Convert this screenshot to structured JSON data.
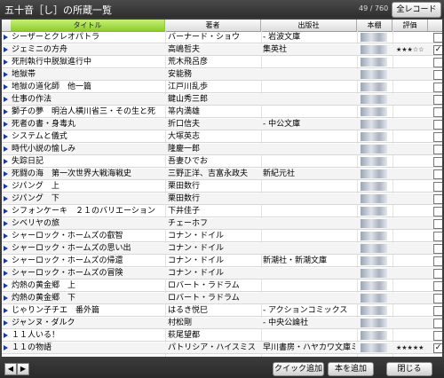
{
  "header": {
    "title": "五十音［し］の所蔵一覧",
    "count": "49 / 760",
    "all_records_button": "全レコード"
  },
  "columns": {
    "title": "タイトル",
    "author": "著者",
    "publisher": "出版社",
    "reference": "本棚",
    "rating": "評価"
  },
  "rows": [
    {
      "title": "シーザーとクレオパトラ",
      "author": "バーナード・ショウ",
      "publisher": "- 岩波文庫",
      "rating": "",
      "checked": false
    },
    {
      "title": "ジェミニの方舟",
      "author": "高嶋哲夫",
      "publisher": "集英社",
      "rating": "★★★☆☆",
      "checked": true
    },
    {
      "title": "死刑執行中脱獄進行中",
      "author": "荒木飛呂彦",
      "publisher": "",
      "rating": "",
      "checked": false
    },
    {
      "title": "地獄帯",
      "author": "安能務",
      "publisher": "",
      "rating": "",
      "checked": false
    },
    {
      "title": "地獄の道化師　他一篇",
      "author": "江戸川乱歩",
      "publisher": "",
      "rating": "",
      "checked": false
    },
    {
      "title": "仕事の作法",
      "author": "鍵山秀三郎",
      "publisher": "",
      "rating": "",
      "checked": false
    },
    {
      "title": "獅子の夢　明治人横川省三・その生と死",
      "author": "箒内満雄",
      "publisher": "",
      "rating": "",
      "checked": false
    },
    {
      "title": "死者の書・身毒丸",
      "author": "折口信夫",
      "publisher": "- 中公文庫",
      "rating": "",
      "checked": false
    },
    {
      "title": "システムと儀式",
      "author": "大塚英志",
      "publisher": "",
      "rating": "",
      "checked": false
    },
    {
      "title": "時代小説の愉しみ",
      "author": "隆慶一郎",
      "publisher": "",
      "rating": "",
      "checked": false
    },
    {
      "title": "失踪日記",
      "author": "吾妻ひでお",
      "publisher": "",
      "rating": "",
      "checked": false
    },
    {
      "title": "死闘の海　第一次世界大戦海戦史",
      "author": "三野正洋、吉富永政夫",
      "publisher": "新紀元社",
      "rating": "",
      "checked": false
    },
    {
      "title": "ジパング　上",
      "author": "栗田数行",
      "publisher": "",
      "rating": "",
      "checked": false
    },
    {
      "title": "ジパング　下",
      "author": "栗田数行",
      "publisher": "",
      "rating": "",
      "checked": false
    },
    {
      "title": "シフォンケーキ　２１のバリエーション",
      "author": "下井佳子",
      "publisher": "",
      "rating": "",
      "checked": false
    },
    {
      "title": "シベリヤの旅",
      "author": "チェーホフ",
      "publisher": "",
      "rating": "",
      "checked": false
    },
    {
      "title": "シャーロック・ホームズの叡智",
      "author": "コナン・ドイル",
      "publisher": "",
      "rating": "",
      "checked": false
    },
    {
      "title": "シャーロック・ホームズの思い出",
      "author": "コナン・ドイル",
      "publisher": "",
      "rating": "",
      "checked": false
    },
    {
      "title": "シャーロック・ホームズの帰還",
      "author": "コナン・ドイル",
      "publisher": "新潮社・新潮文庫",
      "rating": "",
      "checked": false
    },
    {
      "title": "シャーロック・ホームズの冒険",
      "author": "コナン・ドイル",
      "publisher": "",
      "rating": "",
      "checked": false
    },
    {
      "title": "灼熱の黄金郷　上",
      "author": "ロバート・ラドラム",
      "publisher": "",
      "rating": "",
      "checked": false
    },
    {
      "title": "灼熱の黄金郷　下",
      "author": "ロバート・ラドラム",
      "publisher": "",
      "rating": "",
      "checked": false
    },
    {
      "title": "じゃりン子チエ　番外篇",
      "author": "はるき悦巳",
      "publisher": "- アクションコミックス",
      "rating": "",
      "checked": false
    },
    {
      "title": "ジャンヌ・ダルク",
      "author": "村松剛",
      "publisher": "- 中央公論社",
      "rating": "",
      "checked": false
    },
    {
      "title": "１１人いる！",
      "author": "萩尾望都",
      "publisher": "",
      "rating": "",
      "checked": false
    },
    {
      "title": "１１の物語",
      "author": "パトリシア・ハイスミス",
      "publisher": "早川書房・ハヤカワ文庫ミステ",
      "rating": "★★★★★",
      "checked": true
    }
  ],
  "footer": {
    "quick_add": "クイック追加",
    "add_book": "本を追加",
    "close": "閉じる"
  },
  "colors": {
    "title_header": "#8ccc2a",
    "arrow": "#1a3a9c"
  }
}
